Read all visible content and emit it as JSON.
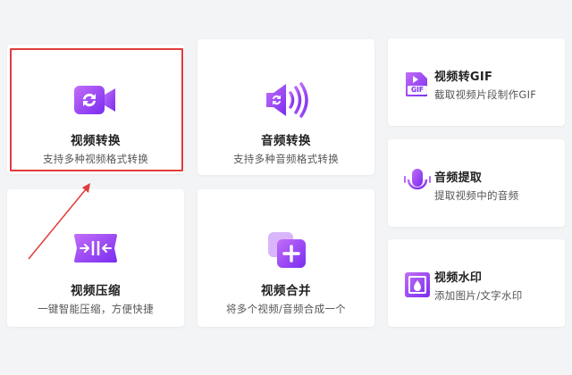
{
  "colors": {
    "accent": "#8b3cf6",
    "highlight": "#e23b3b",
    "background": "#f3f4f6"
  },
  "cards": {
    "video_convert": {
      "title": "视频转换",
      "desc": "支持多种视频格式转换",
      "icon": "video-convert-icon"
    },
    "audio_convert": {
      "title": "音频转换",
      "desc": "支持多种音频格式转换",
      "icon": "audio-convert-icon"
    },
    "video_to_gif": {
      "title": "视频转GIF",
      "desc": "截取视频片段制作GIF",
      "icon": "gif-file-icon",
      "badge": "GIF"
    },
    "audio_extract": {
      "title": "音频提取",
      "desc": "提取视频中的音频",
      "icon": "microphone-icon"
    },
    "video_compress": {
      "title": "视频压缩",
      "desc": "一键智能压缩，方便快捷",
      "icon": "compress-icon"
    },
    "video_merge": {
      "title": "视频合并",
      "desc": "将多个视频/音频合成一个",
      "icon": "merge-plus-icon"
    },
    "video_watermark": {
      "title": "视频水印",
      "desc": "添加图片/文字水印",
      "icon": "watermark-icon"
    }
  },
  "annotations": {
    "highlight_target": "video_convert",
    "arrow": "red-arrow"
  }
}
